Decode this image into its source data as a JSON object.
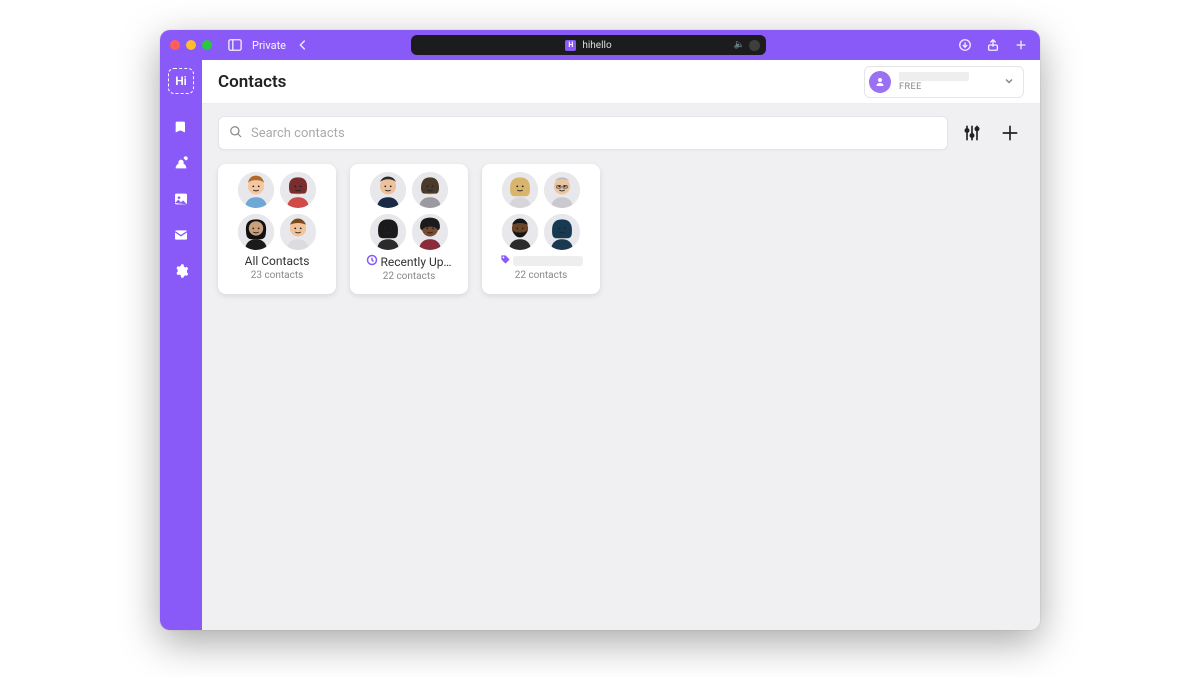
{
  "browser": {
    "private_label": "Private",
    "address_label": "hihello",
    "favicon_letter": "H"
  },
  "sidebar": {
    "logo_text": "Hi"
  },
  "header": {
    "title": "Contacts",
    "plan_label": "FREE"
  },
  "search": {
    "placeholder": "Search contacts"
  },
  "groups": [
    {
      "title": "All Contacts",
      "count_label": "23 contacts",
      "icon": "none",
      "avatars": [
        "m-fair",
        "w-red",
        "w-dark",
        "m-young"
      ]
    },
    {
      "title": "Recently Up…",
      "count_label": "22 contacts",
      "icon": "updated",
      "avatars": [
        "m-biz",
        "w-gray",
        "w-dark2",
        "m-afro"
      ]
    },
    {
      "title": "",
      "count_label": "22 contacts",
      "icon": "tag",
      "placeholder": true,
      "avatars": [
        "w-blonde",
        "m-old",
        "m-beard",
        "w-blue"
      ]
    }
  ]
}
